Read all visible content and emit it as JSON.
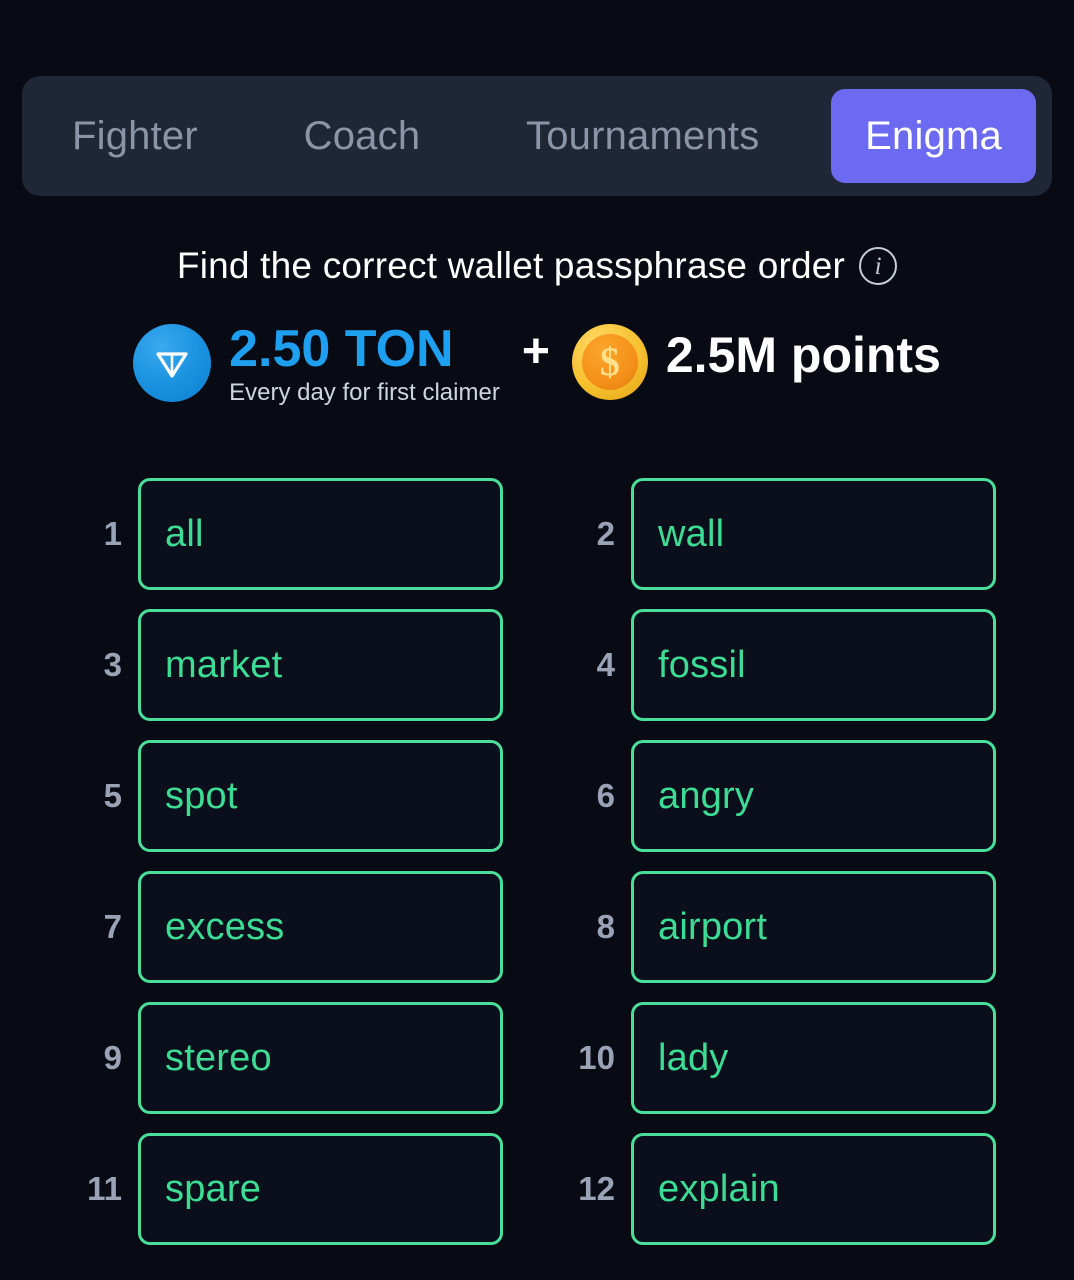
{
  "tabs": [
    {
      "label": "Fighter",
      "active": false
    },
    {
      "label": "Coach",
      "active": false
    },
    {
      "label": "Tournaments",
      "active": false
    },
    {
      "label": "Enigma",
      "active": true
    }
  ],
  "header": {
    "title": "Find the correct wallet passphrase order",
    "info_icon": "info-icon",
    "info_glyph": "i"
  },
  "reward": {
    "ton_icon": "ton-logo-icon",
    "ton_amount": "2.50 TON",
    "ton_subtitle": "Every day for first claimer",
    "plus": "+",
    "coin_icon": "coin-icon",
    "coin_glyph": "$",
    "points_amount": "2.5M points"
  },
  "passphrase": {
    "words": [
      {
        "number": "1",
        "word": "all"
      },
      {
        "number": "2",
        "word": "wall"
      },
      {
        "number": "3",
        "word": "market"
      },
      {
        "number": "4",
        "word": "fossil"
      },
      {
        "number": "5",
        "word": "spot"
      },
      {
        "number": "6",
        "word": "angry"
      },
      {
        "number": "7",
        "word": "excess"
      },
      {
        "number": "8",
        "word": "airport"
      },
      {
        "number": "9",
        "word": "stereo"
      },
      {
        "number": "10",
        "word": "lady"
      },
      {
        "number": "11",
        "word": "spare"
      },
      {
        "number": "12",
        "word": "explain"
      }
    ]
  },
  "colors": {
    "page_background": "#080b14",
    "tabbar_background": "#1f2636",
    "tab_active": "#6c6af0",
    "tab_inactive_text": "#8b95a8",
    "word_border": "#4ade9a",
    "word_text": "#3ddc95",
    "number_text": "#9aa3b5",
    "ton_blue": "#1f9ff0",
    "coin_gold": "#f7c12f"
  }
}
